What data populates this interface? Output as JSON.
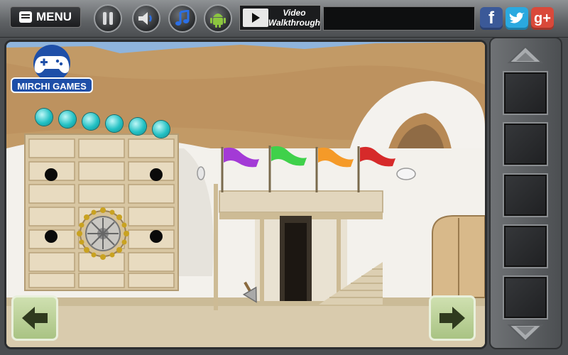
{
  "topbar": {
    "menu_label": "MENU",
    "video_label_line1": "Video",
    "video_label_line2": "Walkthrough"
  },
  "branding": {
    "logo_text": "MIRCHI GAMES"
  },
  "scene": {
    "orbs": 6,
    "flags": [
      "#a33ad6",
      "#3fd14a",
      "#f59a28",
      "#d62a2a"
    ],
    "holes": 4
  },
  "inventory": {
    "slots": 5
  },
  "colors": {
    "facebook": "#3b5998",
    "twitter": "#2aa9e0",
    "googleplus": "#d9493a",
    "nav_button": "#b5cd8f"
  }
}
